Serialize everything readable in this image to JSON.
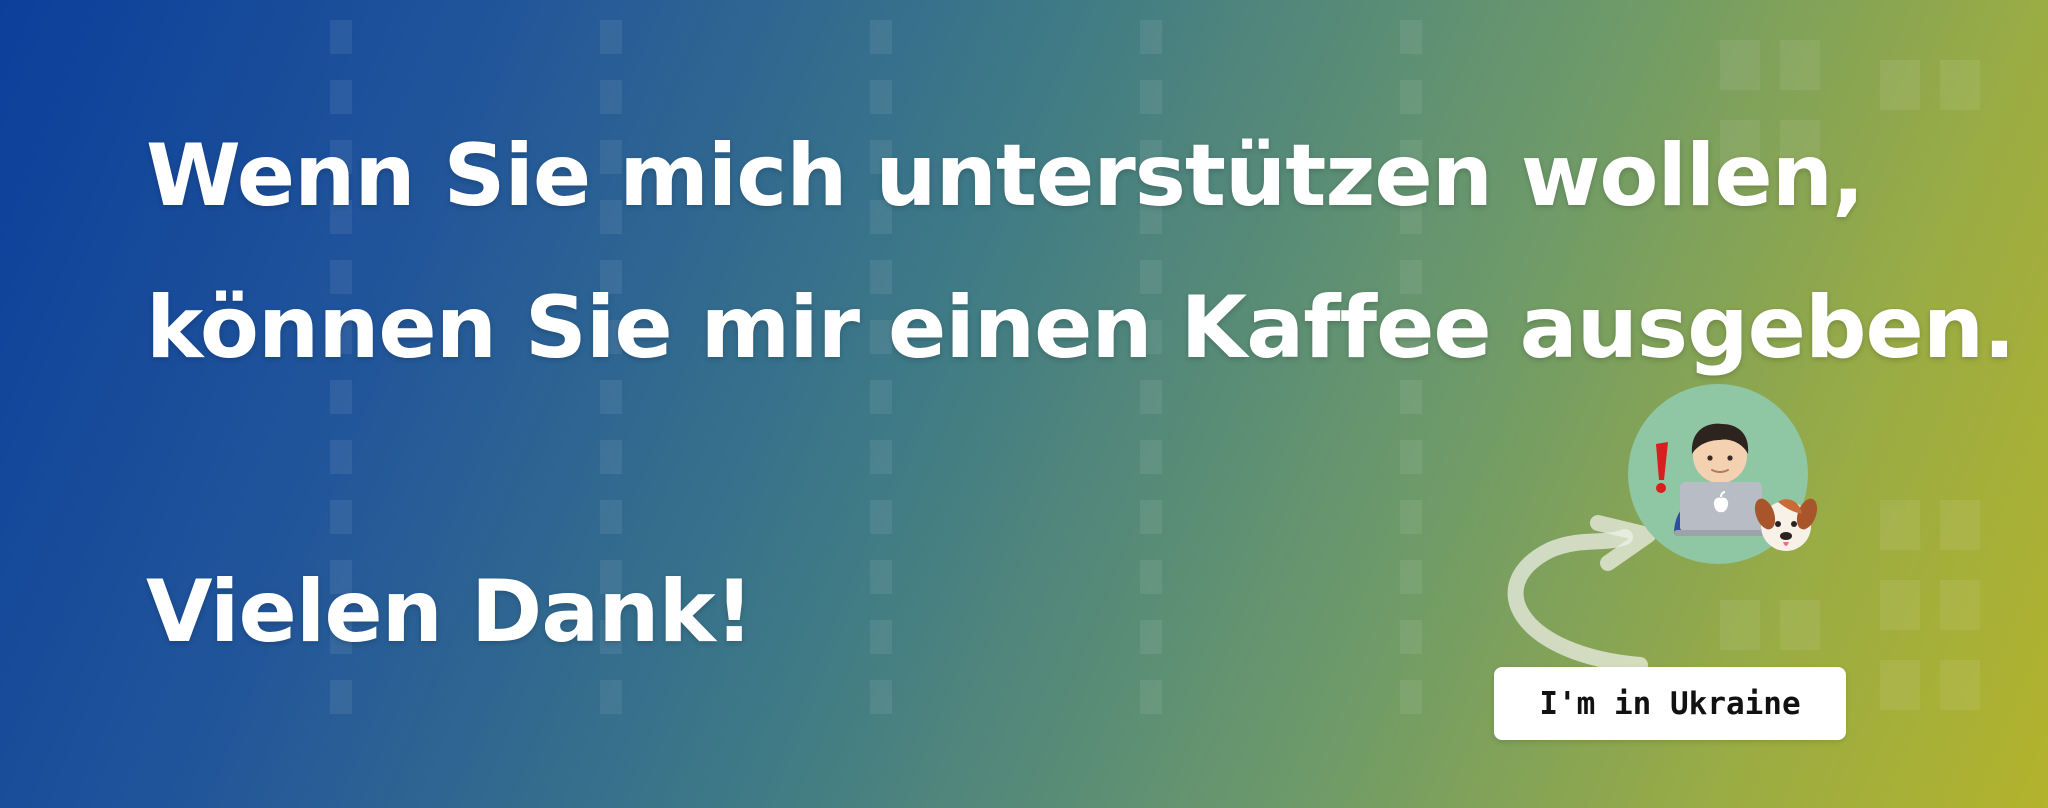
{
  "banner": {
    "headline_line1": "Wenn Sie mich unterstützen wollen,",
    "headline_line2": "können Sie mir einen Kaffee ausgeben.",
    "thanks": "Vielen Dank!",
    "badge_label": "I'm in Ukraine",
    "avatar_icon": "developer-with-laptop-and-dog-icon",
    "colors": {
      "gradient_start": "#0b3f9b",
      "gradient_end": "#b3b32c",
      "avatar_circle": "#8fc6a3",
      "exclamation": "#d81e1e"
    }
  }
}
